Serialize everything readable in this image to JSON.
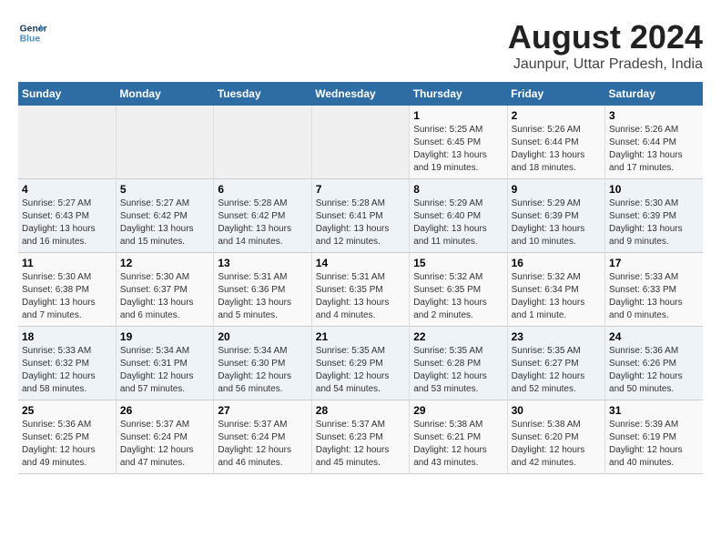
{
  "logo": {
    "line1": "General",
    "line2": "Blue"
  },
  "title": "August 2024",
  "subtitle": "Jaunpur, Uttar Pradesh, India",
  "days_header": [
    "Sunday",
    "Monday",
    "Tuesday",
    "Wednesday",
    "Thursday",
    "Friday",
    "Saturday"
  ],
  "weeks": [
    [
      {
        "day": "",
        "empty": true
      },
      {
        "day": "",
        "empty": true
      },
      {
        "day": "",
        "empty": true
      },
      {
        "day": "",
        "empty": true
      },
      {
        "day": "1",
        "sunrise": "5:25 AM",
        "sunset": "6:45 PM",
        "daylight": "13 hours and 19 minutes."
      },
      {
        "day": "2",
        "sunrise": "5:26 AM",
        "sunset": "6:44 PM",
        "daylight": "13 hours and 18 minutes."
      },
      {
        "day": "3",
        "sunrise": "5:26 AM",
        "sunset": "6:44 PM",
        "daylight": "13 hours and 17 minutes."
      }
    ],
    [
      {
        "day": "4",
        "sunrise": "5:27 AM",
        "sunset": "6:43 PM",
        "daylight": "13 hours and 16 minutes."
      },
      {
        "day": "5",
        "sunrise": "5:27 AM",
        "sunset": "6:42 PM",
        "daylight": "13 hours and 15 minutes."
      },
      {
        "day": "6",
        "sunrise": "5:28 AM",
        "sunset": "6:42 PM",
        "daylight": "13 hours and 14 minutes."
      },
      {
        "day": "7",
        "sunrise": "5:28 AM",
        "sunset": "6:41 PM",
        "daylight": "13 hours and 12 minutes."
      },
      {
        "day": "8",
        "sunrise": "5:29 AM",
        "sunset": "6:40 PM",
        "daylight": "13 hours and 11 minutes."
      },
      {
        "day": "9",
        "sunrise": "5:29 AM",
        "sunset": "6:39 PM",
        "daylight": "13 hours and 10 minutes."
      },
      {
        "day": "10",
        "sunrise": "5:30 AM",
        "sunset": "6:39 PM",
        "daylight": "13 hours and 9 minutes."
      }
    ],
    [
      {
        "day": "11",
        "sunrise": "5:30 AM",
        "sunset": "6:38 PM",
        "daylight": "13 hours and 7 minutes."
      },
      {
        "day": "12",
        "sunrise": "5:30 AM",
        "sunset": "6:37 PM",
        "daylight": "13 hours and 6 minutes."
      },
      {
        "day": "13",
        "sunrise": "5:31 AM",
        "sunset": "6:36 PM",
        "daylight": "13 hours and 5 minutes."
      },
      {
        "day": "14",
        "sunrise": "5:31 AM",
        "sunset": "6:35 PM",
        "daylight": "13 hours and 4 minutes."
      },
      {
        "day": "15",
        "sunrise": "5:32 AM",
        "sunset": "6:35 PM",
        "daylight": "13 hours and 2 minutes."
      },
      {
        "day": "16",
        "sunrise": "5:32 AM",
        "sunset": "6:34 PM",
        "daylight": "13 hours and 1 minute."
      },
      {
        "day": "17",
        "sunrise": "5:33 AM",
        "sunset": "6:33 PM",
        "daylight": "13 hours and 0 minutes."
      }
    ],
    [
      {
        "day": "18",
        "sunrise": "5:33 AM",
        "sunset": "6:32 PM",
        "daylight": "12 hours and 58 minutes."
      },
      {
        "day": "19",
        "sunrise": "5:34 AM",
        "sunset": "6:31 PM",
        "daylight": "12 hours and 57 minutes."
      },
      {
        "day": "20",
        "sunrise": "5:34 AM",
        "sunset": "6:30 PM",
        "daylight": "12 hours and 56 minutes."
      },
      {
        "day": "21",
        "sunrise": "5:35 AM",
        "sunset": "6:29 PM",
        "daylight": "12 hours and 54 minutes."
      },
      {
        "day": "22",
        "sunrise": "5:35 AM",
        "sunset": "6:28 PM",
        "daylight": "12 hours and 53 minutes."
      },
      {
        "day": "23",
        "sunrise": "5:35 AM",
        "sunset": "6:27 PM",
        "daylight": "12 hours and 52 minutes."
      },
      {
        "day": "24",
        "sunrise": "5:36 AM",
        "sunset": "6:26 PM",
        "daylight": "12 hours and 50 minutes."
      }
    ],
    [
      {
        "day": "25",
        "sunrise": "5:36 AM",
        "sunset": "6:25 PM",
        "daylight": "12 hours and 49 minutes."
      },
      {
        "day": "26",
        "sunrise": "5:37 AM",
        "sunset": "6:24 PM",
        "daylight": "12 hours and 47 minutes."
      },
      {
        "day": "27",
        "sunrise": "5:37 AM",
        "sunset": "6:24 PM",
        "daylight": "12 hours and 46 minutes."
      },
      {
        "day": "28",
        "sunrise": "5:37 AM",
        "sunset": "6:23 PM",
        "daylight": "12 hours and 45 minutes."
      },
      {
        "day": "29",
        "sunrise": "5:38 AM",
        "sunset": "6:21 PM",
        "daylight": "12 hours and 43 minutes."
      },
      {
        "day": "30",
        "sunrise": "5:38 AM",
        "sunset": "6:20 PM",
        "daylight": "12 hours and 42 minutes."
      },
      {
        "day": "31",
        "sunrise": "5:39 AM",
        "sunset": "6:19 PM",
        "daylight": "12 hours and 40 minutes."
      }
    ]
  ]
}
